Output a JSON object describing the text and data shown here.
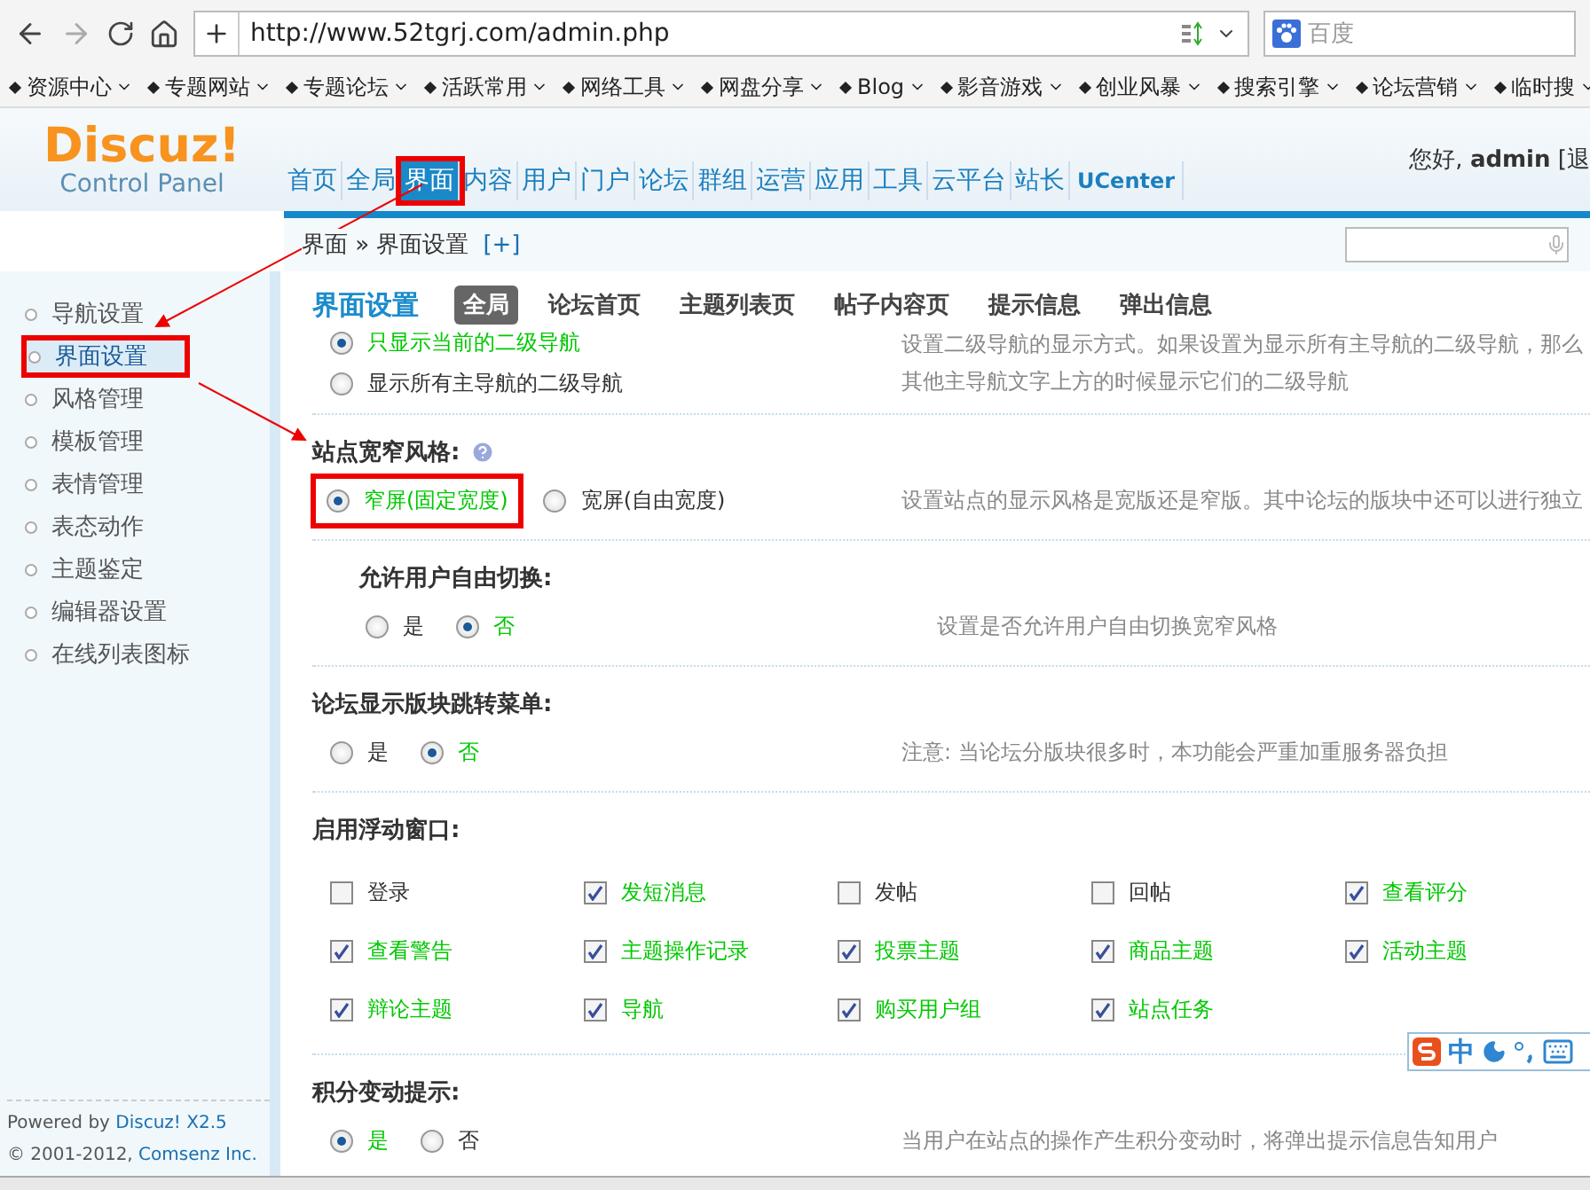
{
  "browser": {
    "url": "http://www.52tgrj.com/admin.php",
    "search": {
      "placeholder": "百度"
    },
    "bookmarks": [
      "资源中心",
      "专题网站",
      "专题论坛",
      "活跃常用",
      "网络工具",
      "网盘分享",
      "Blog",
      "影音游戏",
      "创业风暴",
      "搜索引擎",
      "论坛营销",
      "临时搜"
    ]
  },
  "header": {
    "logo": "Discuz!",
    "logo_sub": "Control Panel",
    "greeting": "您好, **admin** [退",
    "nav": [
      {
        "label": "首页",
        "selected": false
      },
      {
        "label": "全局",
        "selected": false
      },
      {
        "label": "界面",
        "selected": true,
        "annotated": true
      },
      {
        "label": "内容",
        "selected": false
      },
      {
        "label": "用户",
        "selected": false
      },
      {
        "label": "门户",
        "selected": false
      },
      {
        "label": "论坛",
        "selected": false
      },
      {
        "label": "群组",
        "selected": false
      },
      {
        "label": "运营",
        "selected": false
      },
      {
        "label": "应用",
        "selected": false
      },
      {
        "label": "工具",
        "selected": false
      },
      {
        "label": "云平台",
        "selected": false
      },
      {
        "label": "站长",
        "selected": false
      },
      {
        "label": "UCenter",
        "selected": false
      }
    ]
  },
  "breadcrumb": {
    "path": "界面 » 界面设置",
    "add": "[+]"
  },
  "sidebar": {
    "items": [
      {
        "label": "导航设置",
        "selected": false
      },
      {
        "label": "界面设置",
        "selected": true,
        "annotated": true
      },
      {
        "label": "风格管理",
        "selected": false
      },
      {
        "label": "模板管理",
        "selected": false
      },
      {
        "label": "表情管理",
        "selected": false
      },
      {
        "label": "表态动作",
        "selected": false
      },
      {
        "label": "主题鉴定",
        "selected": false
      },
      {
        "label": "编辑器设置",
        "selected": false
      },
      {
        "label": "在线列表图标",
        "selected": false
      }
    ],
    "footer": [
      "Powered by **Discuz! X2.5**",
      "© 2001-2012, **Comsenz Inc.**"
    ]
  },
  "page": {
    "title": "界面设置",
    "tabs": [
      {
        "label": "全局",
        "selected": true
      },
      {
        "label": "论坛首页",
        "selected": false
      },
      {
        "label": "主题列表页",
        "selected": false
      },
      {
        "label": "帖子内容页",
        "selected": false
      },
      {
        "label": "提示信息",
        "selected": false
      },
      {
        "label": "弹出信息",
        "selected": false
      }
    ]
  },
  "settings": [
    {
      "kind": "radio",
      "vertical": true,
      "options": [
        {
          "label": "只显示当前的二级导航",
          "selected": true
        },
        {
          "label": "显示所有主导航的二级导航",
          "selected": false
        }
      ],
      "description": [
        "设置二级导航的显示方式。如果设置为显示所有主导航的二级导航，那么",
        "其他主导航文字上方的时候显示它们的二级导航"
      ]
    },
    {
      "kind": "radio",
      "title": "站点宽窄风格:",
      "help": true,
      "options": [
        {
          "label": "窄屏(固定宽度)",
          "selected": true,
          "annotated": true
        },
        {
          "label": "宽屏(自由宽度)",
          "selected": false
        }
      ],
      "description": [
        "设置站点的显示风格是宽版还是窄版。其中论坛的版块中还可以进行独立"
      ]
    },
    {
      "kind": "radio",
      "title": "允许用户自由切换:",
      "indented": true,
      "options": [
        {
          "label": "是",
          "selected": false
        },
        {
          "label": "否",
          "selected": true
        }
      ],
      "description": [
        "设置是否允许用户自由切换宽窄风格"
      ]
    },
    {
      "kind": "radio",
      "title": "论坛显示版块跳转菜单:",
      "options": [
        {
          "label": "是",
          "selected": false
        },
        {
          "label": "否",
          "selected": true
        }
      ],
      "description": [
        "注意: 当论坛分版块很多时，本功能会严重加重服务器负担"
      ]
    },
    {
      "kind": "checkboxes",
      "title": "启用浮动窗口:",
      "options": [
        {
          "label": "登录",
          "checked": false
        },
        {
          "label": "发短消息",
          "checked": true
        },
        {
          "label": "发帖",
          "checked": false
        },
        {
          "label": "回帖",
          "checked": false
        },
        {
          "label": "查看评分",
          "checked": true
        },
        {
          "label": "查看警告",
          "checked": true
        },
        {
          "label": "主题操作记录",
          "checked": true
        },
        {
          "label": "投票主题",
          "checked": true
        },
        {
          "label": "商品主题",
          "checked": true
        },
        {
          "label": "活动主题",
          "checked": true
        },
        {
          "label": "辩论主题",
          "checked": true
        },
        {
          "label": "导航",
          "checked": true
        },
        {
          "label": "购买用户组",
          "checked": true
        },
        {
          "label": "站点任务",
          "checked": true
        }
      ]
    },
    {
      "kind": "radio",
      "title": "积分变动提示:",
      "options": [
        {
          "label": "是",
          "selected": true
        },
        {
          "label": "否",
          "selected": false
        }
      ],
      "description": [
        "当用户在站点的操作产生积分变动时，将弹出提示信息告知用户"
      ]
    }
  ],
  "ime_bar": {
    "mode": "中"
  }
}
